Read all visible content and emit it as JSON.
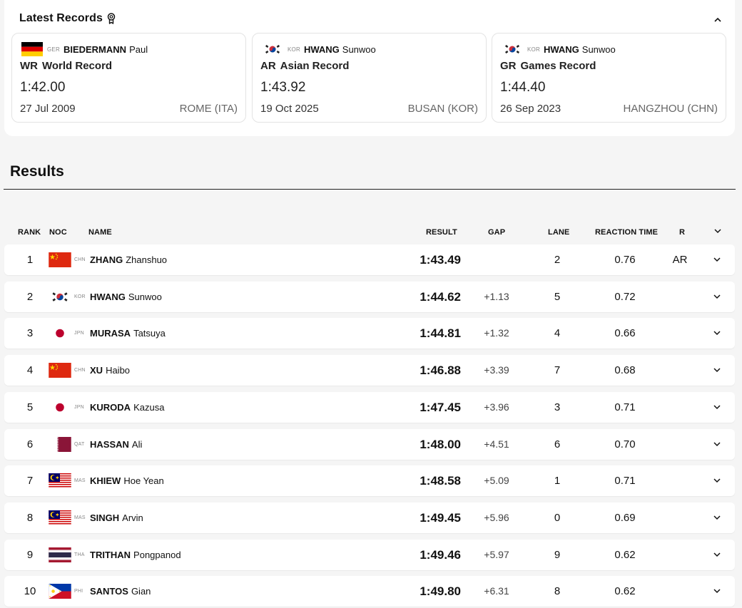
{
  "records": {
    "title": "Latest Records",
    "items": [
      {
        "flag": "ger",
        "noc": "GER",
        "surname": "BIEDERMANN",
        "given": "Paul",
        "code": "WR",
        "label": "World Record",
        "time": "1:42.00",
        "date": "27 Jul 2009",
        "venue": "ROME (ITA)"
      },
      {
        "flag": "kor",
        "noc": "KOR",
        "surname": "HWANG",
        "given": "Sunwoo",
        "code": "AR",
        "label": "Asian Record",
        "time": "1:43.92",
        "date": "19 Oct 2025",
        "venue": "BUSAN (KOR)"
      },
      {
        "flag": "kor",
        "noc": "KOR",
        "surname": "HWANG",
        "given": "Sunwoo",
        "code": "GR",
        "label": "Games Record",
        "time": "1:44.40",
        "date": "26 Sep 2023",
        "venue": "HANGZHOU (CHN)"
      }
    ]
  },
  "results": {
    "title": "Results",
    "columns": {
      "rank": "RANK",
      "noc": "NOC",
      "name": "NAME",
      "result": "RESULT",
      "gap": "GAP",
      "lane": "LANE",
      "reaction": "REACTION TIME",
      "record": "R"
    },
    "rows": [
      {
        "rank": "1",
        "flag": "chn",
        "noc": "CHN",
        "surname": "ZHANG",
        "given": "Zhanshuo",
        "result": "1:43.49",
        "gap": "",
        "lane": "2",
        "reaction": "0.76",
        "record": "AR"
      },
      {
        "rank": "2",
        "flag": "kor",
        "noc": "KOR",
        "surname": "HWANG",
        "given": "Sunwoo",
        "result": "1:44.62",
        "gap": "+1.13",
        "lane": "5",
        "reaction": "0.72",
        "record": ""
      },
      {
        "rank": "3",
        "flag": "jpn",
        "noc": "JPN",
        "surname": "MURASA",
        "given": "Tatsuya",
        "result": "1:44.81",
        "gap": "+1.32",
        "lane": "4",
        "reaction": "0.66",
        "record": ""
      },
      {
        "rank": "4",
        "flag": "chn",
        "noc": "CHN",
        "surname": "XU",
        "given": "Haibo",
        "result": "1:46.88",
        "gap": "+3.39",
        "lane": "7",
        "reaction": "0.68",
        "record": ""
      },
      {
        "rank": "5",
        "flag": "jpn",
        "noc": "JPN",
        "surname": "KURODA",
        "given": "Kazusa",
        "result": "1:47.45",
        "gap": "+3.96",
        "lane": "3",
        "reaction": "0.71",
        "record": ""
      },
      {
        "rank": "6",
        "flag": "qat",
        "noc": "QAT",
        "surname": "HASSAN",
        "given": "Ali",
        "result": "1:48.00",
        "gap": "+4.51",
        "lane": "6",
        "reaction": "0.70",
        "record": ""
      },
      {
        "rank": "7",
        "flag": "mas",
        "noc": "MAS",
        "surname": "KHIEW",
        "given": "Hoe Yean",
        "result": "1:48.58",
        "gap": "+5.09",
        "lane": "1",
        "reaction": "0.71",
        "record": ""
      },
      {
        "rank": "8",
        "flag": "mas",
        "noc": "MAS",
        "surname": "SINGH",
        "given": "Arvin",
        "result": "1:49.45",
        "gap": "+5.96",
        "lane": "0",
        "reaction": "0.69",
        "record": ""
      },
      {
        "rank": "9",
        "flag": "tha",
        "noc": "THA",
        "surname": "TRITHAN",
        "given": "Pongpanod",
        "result": "1:49.46",
        "gap": "+5.97",
        "lane": "9",
        "reaction": "0.62",
        "record": ""
      },
      {
        "rank": "10",
        "flag": "phi",
        "noc": "PHI",
        "surname": "SANTOS",
        "given": "Gian",
        "result": "1:49.80",
        "gap": "+6.31",
        "lane": "8",
        "reaction": "0.62",
        "record": ""
      }
    ]
  },
  "icons": {
    "records": "medal-icon",
    "collapse": "chevron-up-icon",
    "expand": "chevron-down-icon"
  }
}
